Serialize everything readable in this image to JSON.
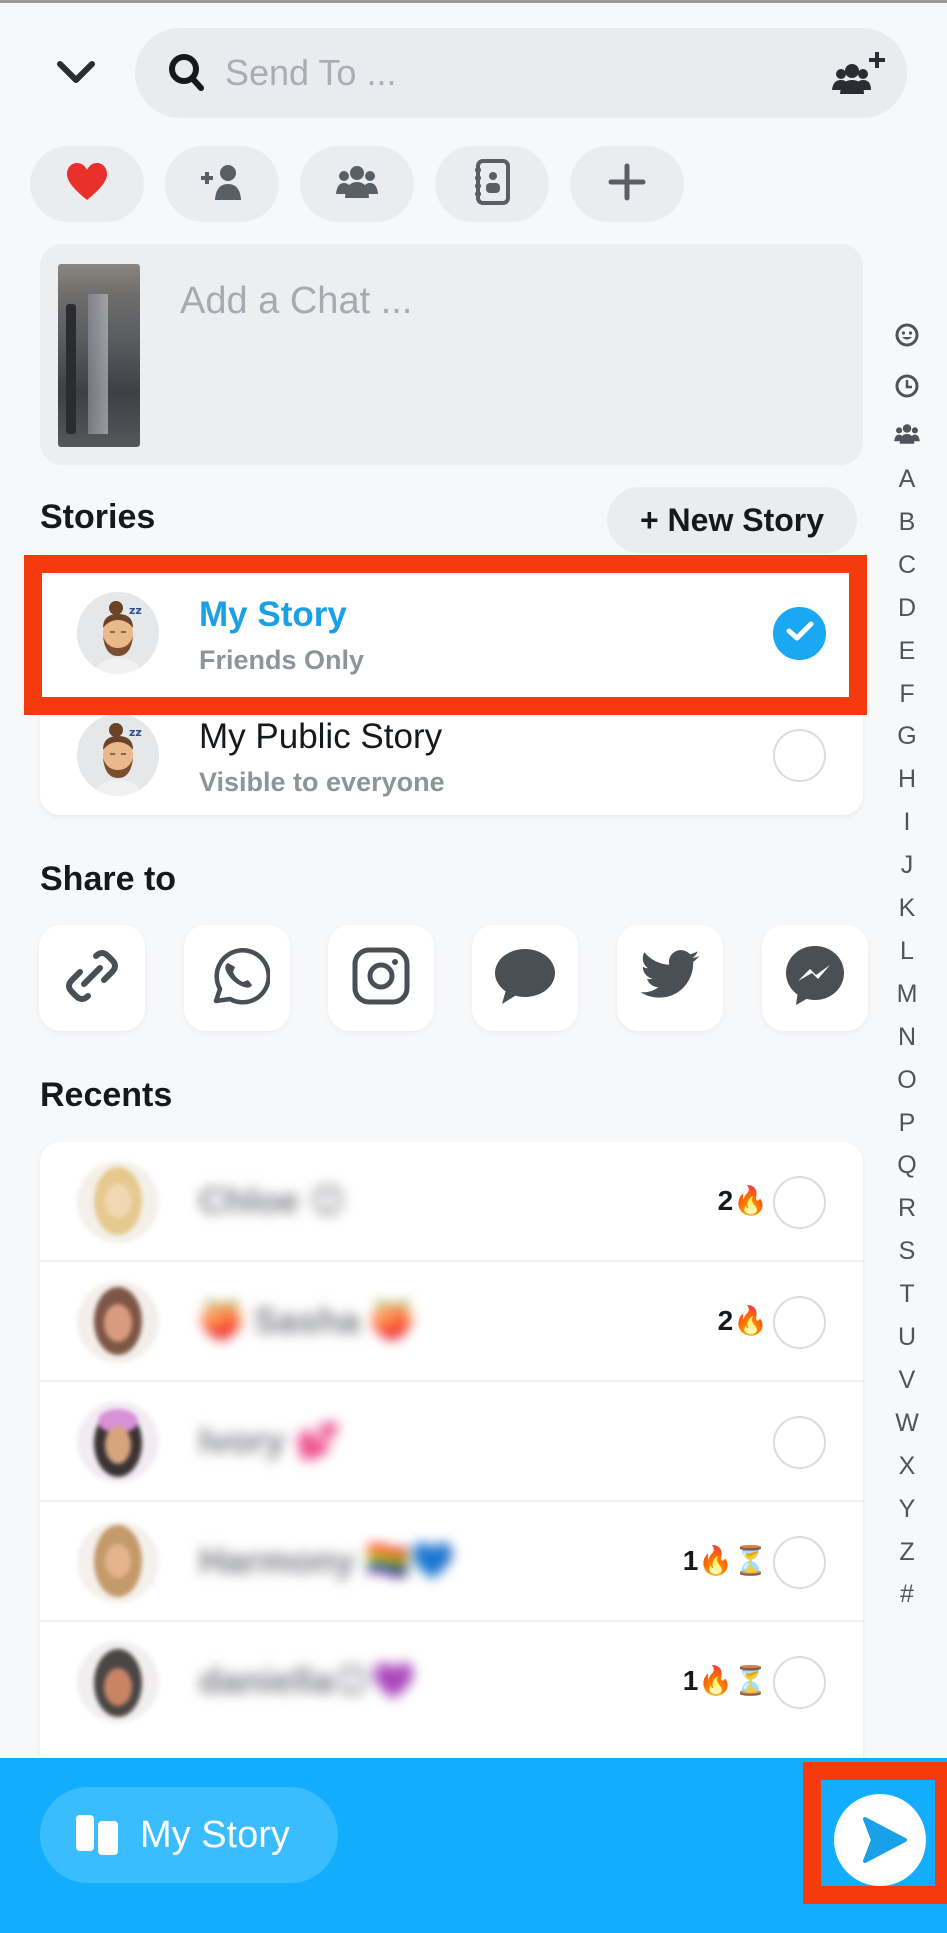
{
  "header": {
    "back_icon": "chevron-down-icon",
    "search_icon": "search-icon",
    "search_placeholder": "Send To ...",
    "search_value": "",
    "add_group_icon": "group-add-icon"
  },
  "quick_filters": [
    {
      "icon": "heart-icon",
      "label": "Best Friends"
    },
    {
      "icon": "add-friend-icon",
      "label": "Add Friend"
    },
    {
      "icon": "groups-icon",
      "label": "Groups"
    },
    {
      "icon": "contacts-book-icon",
      "label": "Contacts"
    },
    {
      "icon": "plus-icon",
      "label": "More"
    }
  ],
  "add_chat": {
    "placeholder": "Add a Chat ..."
  },
  "stories": {
    "title": "Stories",
    "new_story_label": "+ New Story",
    "items": [
      {
        "title": "My Story",
        "subtitle": "Friends Only",
        "selected": true,
        "highlighted": true
      },
      {
        "title": "My Public Story",
        "subtitle": "Visible to everyone",
        "selected": false,
        "highlighted": false
      }
    ]
  },
  "share_to": {
    "title": "Share to",
    "targets": [
      {
        "icon": "link-icon",
        "label": "Copy Link"
      },
      {
        "icon": "whatsapp-icon",
        "label": "WhatsApp"
      },
      {
        "icon": "instagram-icon",
        "label": "Instagram"
      },
      {
        "icon": "message-bubble-icon",
        "label": "Messages"
      },
      {
        "icon": "twitter-icon",
        "label": "Twitter"
      },
      {
        "icon": "messenger-icon",
        "label": "Messenger"
      }
    ]
  },
  "recents": {
    "title": "Recents",
    "items": [
      {
        "name": "Chloe 😊",
        "streak": "2🔥",
        "selected": false
      },
      {
        "name": "🍑 Sasha 🍑",
        "streak": "2🔥",
        "selected": false
      },
      {
        "name": "Ivory 💕",
        "streak": "",
        "selected": false
      },
      {
        "name": "Harmony 🏳️‍🌈💙",
        "streak": "1🔥⏳",
        "selected": false
      },
      {
        "name": "daniella😊💜",
        "streak": "1🔥⏳",
        "selected": false
      }
    ]
  },
  "index_bar": {
    "icons": [
      "smiley-icon",
      "clock-icon",
      "groups-icon"
    ],
    "letters": [
      "A",
      "B",
      "C",
      "D",
      "E",
      "F",
      "G",
      "H",
      "I",
      "J",
      "K",
      "L",
      "M",
      "N",
      "O",
      "P",
      "Q",
      "R",
      "S",
      "T",
      "U",
      "V",
      "W",
      "X",
      "Y",
      "Z",
      "#"
    ]
  },
  "bottom_bar": {
    "selected_label": "My Story",
    "selected_icon": "stories-icon",
    "send_icon": "send-arrow-icon"
  },
  "colors": {
    "accent_blue": "#13ADFE",
    "selected_blue": "#1AA8F2",
    "title_blue": "#1AA0E6",
    "annotation_red": "#F53A0E"
  }
}
